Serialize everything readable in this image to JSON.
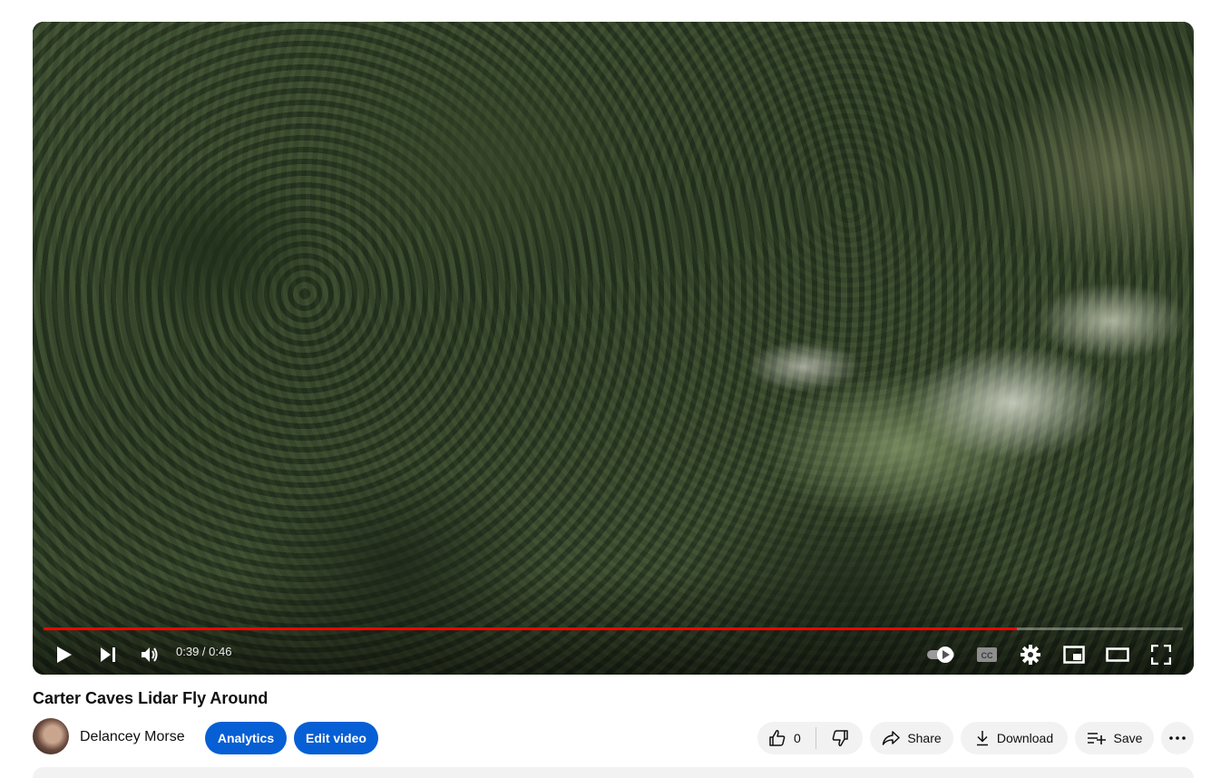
{
  "video": {
    "time_display": "0:39 / 0:46",
    "progress_fraction": 0.854,
    "progress_color": "#ff0000"
  },
  "player_controls": {
    "play": "play-icon",
    "next": "next-icon",
    "volume": "volume-icon",
    "autoplay": "autoplay-toggle-icon",
    "captions": "captions-icon",
    "settings": "settings-gear-icon",
    "miniplayer": "miniplayer-icon",
    "theater": "theater-mode-icon",
    "fullscreen": "fullscreen-icon"
  },
  "title": "Carter Caves Lidar Fly Around",
  "channel": {
    "name": "Delancey Morse"
  },
  "actions": {
    "analytics_label": "Analytics",
    "edit_label": "Edit video",
    "like_count": "0",
    "share_label": "Share",
    "download_label": "Download",
    "save_label": "Save"
  },
  "colors": {
    "primary_button": "#065fd4",
    "secondary_button": "#f2f2f2"
  }
}
